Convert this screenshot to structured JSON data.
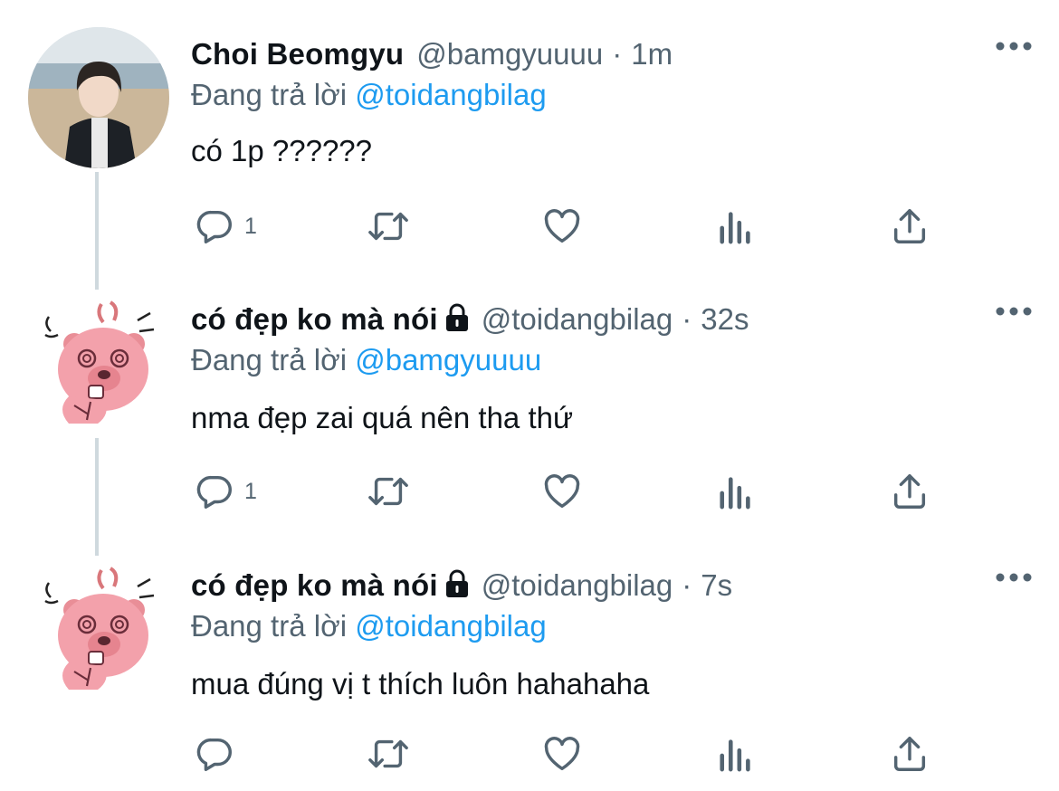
{
  "tweets": [
    {
      "name": "Choi Beomgyu",
      "handle": "@bamgyuuuu",
      "time": "1m",
      "replying_label": "Đang trả lời",
      "replying_to": "@toidangbilag",
      "text": "có 1p ??????",
      "reply_count": "1",
      "locked": false
    },
    {
      "name": "có đẹp ko mà nói",
      "handle": "@toidangbilag",
      "time": "32s",
      "replying_label": "Đang trả lời",
      "replying_to": "@bamgyuuuu",
      "text": "nma đẹp zai quá nên tha thứ",
      "reply_count": "1",
      "locked": true
    },
    {
      "name": "có đẹp ko mà nói",
      "handle": "@toidangbilag",
      "time": "7s",
      "replying_label": "Đang trả lời",
      "replying_to": "@toidangbilag",
      "text": "mua đúng vị t thích luôn hahahaha",
      "reply_count": "",
      "locked": true
    }
  ],
  "separator": "·",
  "icons": [
    "reply-icon",
    "retweet-icon",
    "like-icon",
    "analytics-icon",
    "share-icon",
    "more-icon",
    "lock-icon"
  ],
  "colors": {
    "text": "#0f1419",
    "secondary": "#536471",
    "link": "#1d9bf0",
    "thread": "#cfd9de"
  }
}
